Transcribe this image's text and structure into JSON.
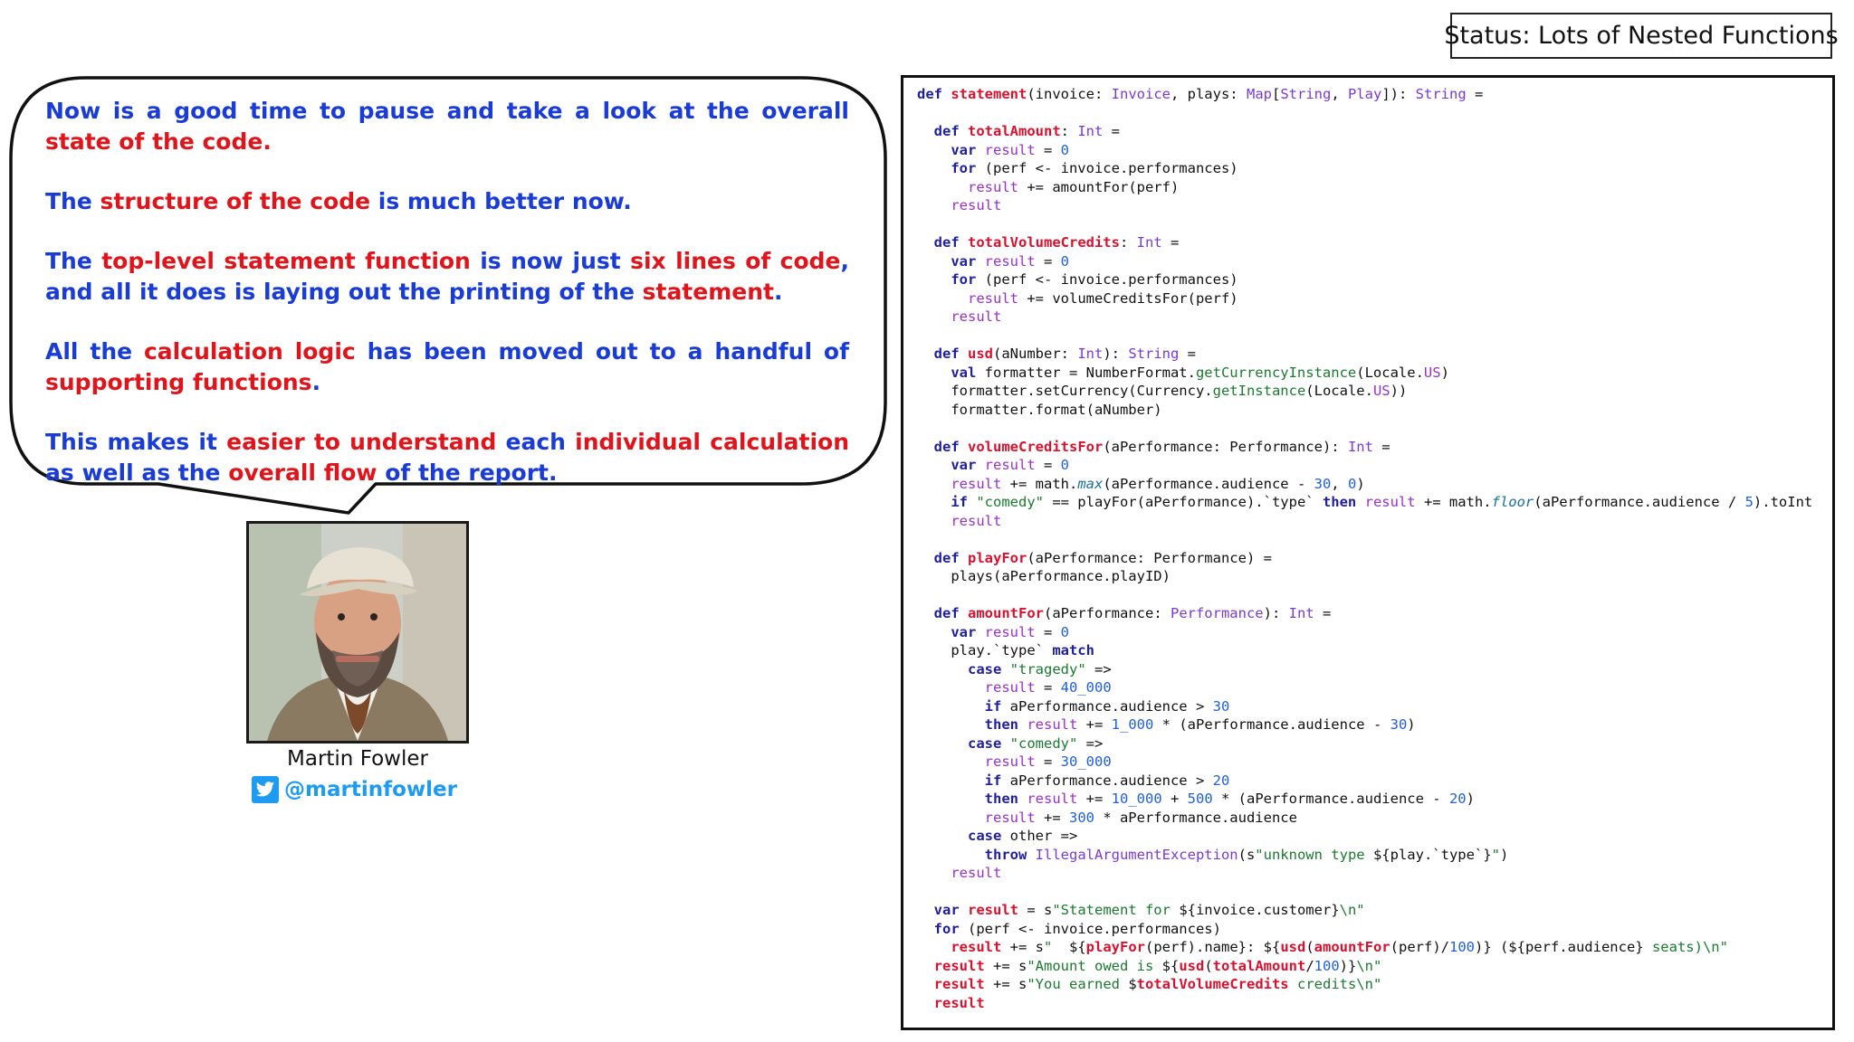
{
  "status": {
    "label": "Status: Lots of Nested Functions"
  },
  "bubble": {
    "paragraphs": [
      [
        {
          "text": "Now is a good time to pause and take a look at the overall ",
          "hl": false
        },
        {
          "text": "state of the code",
          "hl": true
        },
        {
          "text": ".",
          "hl": true
        }
      ],
      [
        {
          "text": "The ",
          "hl": false
        },
        {
          "text": "structure of the code",
          "hl": true
        },
        {
          "text": " is much better now.",
          "hl": false
        }
      ],
      [
        {
          "text": "The ",
          "hl": false
        },
        {
          "text": "top-level statement function",
          "hl": true
        },
        {
          "text": " is now just ",
          "hl": false
        },
        {
          "text": "six lines of code",
          "hl": true
        },
        {
          "text": ", and all it does is laying out the printing of the ",
          "hl": false
        },
        {
          "text": "statement",
          "hl": true
        },
        {
          "text": ".",
          "hl": false
        }
      ],
      [
        {
          "text": "All the ",
          "hl": false
        },
        {
          "text": "calculation logic",
          "hl": true
        },
        {
          "text": " has been moved out to a handful of ",
          "hl": false
        },
        {
          "text": "supporting functions",
          "hl": true
        },
        {
          "text": ".",
          "hl": false
        }
      ],
      [
        {
          "text": "This makes it ",
          "hl": false
        },
        {
          "text": "easier to understand",
          "hl": true
        },
        {
          "text": " each ",
          "hl": false
        },
        {
          "text": "individual calculation",
          "hl": true
        },
        {
          "text": " as well as the ",
          "hl": false
        },
        {
          "text": "overall flow",
          "hl": true
        },
        {
          "text": " of the report.",
          "hl": false
        }
      ]
    ]
  },
  "author": {
    "name": "Martin Fowler",
    "twitter_handle": "@martinfowler",
    "twitter_icon": "twitter-bird-icon",
    "photo_icon": "author-portrait"
  },
  "colors": {
    "highlight": "#e0141b",
    "text": "#1a3cd6",
    "twitter": "#1d9bf0",
    "keyword": "#1f1f9c",
    "function_name": "#d8112e",
    "type": "#7a3ad1",
    "number": "#2060d8"
  },
  "code": {
    "language": "scala",
    "lines": [
      [
        [
          "k",
          "def "
        ],
        [
          "f",
          "statement"
        ],
        [
          "",
          "(invoice: "
        ],
        [
          "t",
          "Invoice"
        ],
        [
          "",
          ", plays: "
        ],
        [
          "t",
          "Map"
        ],
        [
          "",
          "["
        ],
        [
          "t",
          "String"
        ],
        [
          "",
          ", "
        ],
        [
          "t",
          "Play"
        ],
        [
          "",
          "]): "
        ],
        [
          "t",
          "String"
        ],
        [
          "",
          " ="
        ]
      ],
      [],
      [
        [
          "",
          "  "
        ],
        [
          "k",
          "def "
        ],
        [
          "f",
          "totalAmount"
        ],
        [
          "",
          ": "
        ],
        [
          "t",
          "Int"
        ],
        [
          "",
          " ="
        ]
      ],
      [
        [
          "",
          "    "
        ],
        [
          "k",
          "var "
        ],
        [
          "v",
          "result"
        ],
        [
          "",
          " = "
        ],
        [
          "n",
          "0"
        ]
      ],
      [
        [
          "",
          "    "
        ],
        [
          "k",
          "for "
        ],
        [
          "",
          "(perf <- invoice.performances)"
        ]
      ],
      [
        [
          "",
          "      "
        ],
        [
          "v",
          "result"
        ],
        [
          "",
          " += amountFor(perf)"
        ]
      ],
      [
        [
          "",
          "    "
        ],
        [
          "v",
          "result"
        ]
      ],
      [],
      [
        [
          "",
          "  "
        ],
        [
          "k",
          "def "
        ],
        [
          "f",
          "totalVolumeCredits"
        ],
        [
          "",
          ": "
        ],
        [
          "t",
          "Int"
        ],
        [
          "",
          " ="
        ]
      ],
      [
        [
          "",
          "    "
        ],
        [
          "k",
          "var "
        ],
        [
          "v",
          "result"
        ],
        [
          "",
          " = "
        ],
        [
          "n",
          "0"
        ]
      ],
      [
        [
          "",
          "    "
        ],
        [
          "k",
          "for "
        ],
        [
          "",
          "(perf <- invoice.performances)"
        ]
      ],
      [
        [
          "",
          "      "
        ],
        [
          "v",
          "result"
        ],
        [
          "",
          " += volumeCreditsFor(perf)"
        ]
      ],
      [
        [
          "",
          "    "
        ],
        [
          "v",
          "result"
        ]
      ],
      [],
      [
        [
          "",
          "  "
        ],
        [
          "k",
          "def "
        ],
        [
          "f",
          "usd"
        ],
        [
          "",
          "(aNumber: "
        ],
        [
          "t",
          "Int"
        ],
        [
          "",
          "): "
        ],
        [
          "t",
          "String"
        ],
        [
          "",
          " ="
        ]
      ],
      [
        [
          "",
          "    "
        ],
        [
          "k",
          "val "
        ],
        [
          "",
          "formatter = NumberFormat."
        ],
        [
          "s",
          "getCurrencyInstance"
        ],
        [
          "",
          "(Locale."
        ],
        [
          "v",
          "US"
        ],
        [
          "",
          ")"
        ]
      ],
      [
        [
          "",
          "    formatter.setCurrency(Currency."
        ],
        [
          "s",
          "getInstance"
        ],
        [
          "",
          "(Locale."
        ],
        [
          "v",
          "US"
        ],
        [
          "",
          "))"
        ]
      ],
      [
        [
          "",
          "    formatter.format(aNumber)"
        ]
      ],
      [],
      [
        [
          "",
          "  "
        ],
        [
          "k",
          "def "
        ],
        [
          "f",
          "volumeCreditsFor"
        ],
        [
          "",
          "(aPerformance: Performance): "
        ],
        [
          "t",
          "Int"
        ],
        [
          "",
          " ="
        ]
      ],
      [
        [
          "",
          "    "
        ],
        [
          "k",
          "var "
        ],
        [
          "v",
          "result"
        ],
        [
          "",
          " = "
        ],
        [
          "n",
          "0"
        ]
      ],
      [
        [
          "",
          "    "
        ],
        [
          "v",
          "result"
        ],
        [
          "",
          " += math."
        ],
        [
          "i",
          "max"
        ],
        [
          "",
          "(aPerformance.audience - "
        ],
        [
          "n",
          "30"
        ],
        [
          "",
          ", "
        ],
        [
          "n",
          "0"
        ],
        [
          "",
          ")"
        ]
      ],
      [
        [
          "",
          "    "
        ],
        [
          "k",
          "if "
        ],
        [
          "s",
          "\"comedy\""
        ],
        [
          "",
          " == playFor(aPerformance).`type` "
        ],
        [
          "k",
          "then "
        ],
        [
          "v",
          "result"
        ],
        [
          "",
          " += math."
        ],
        [
          "i",
          "floor"
        ],
        [
          "",
          "(aPerformance.audience / "
        ],
        [
          "n",
          "5"
        ],
        [
          "",
          ").toInt"
        ]
      ],
      [
        [
          "",
          "    "
        ],
        [
          "v",
          "result"
        ]
      ],
      [],
      [
        [
          "",
          "  "
        ],
        [
          "k",
          "def "
        ],
        [
          "f",
          "playFor"
        ],
        [
          "",
          "(aPerformance: Performance) ="
        ]
      ],
      [
        [
          "",
          "    plays(aPerformance.playID)"
        ]
      ],
      [],
      [
        [
          "",
          "  "
        ],
        [
          "k",
          "def "
        ],
        [
          "f",
          "amountFor"
        ],
        [
          "",
          "(aPerformance: "
        ],
        [
          "t",
          "Performance"
        ],
        [
          "",
          "): "
        ],
        [
          "t",
          "Int"
        ],
        [
          "",
          " ="
        ]
      ],
      [
        [
          "",
          "    "
        ],
        [
          "k",
          "var "
        ],
        [
          "v",
          "result"
        ],
        [
          "",
          " = "
        ],
        [
          "n",
          "0"
        ]
      ],
      [
        [
          "",
          "    play.`type` "
        ],
        [
          "k",
          "match"
        ]
      ],
      [
        [
          "",
          "      "
        ],
        [
          "k",
          "case "
        ],
        [
          "s",
          "\"tragedy\""
        ],
        [
          "",
          " =>"
        ]
      ],
      [
        [
          "",
          "        "
        ],
        [
          "v",
          "result"
        ],
        [
          "",
          " = "
        ],
        [
          "n",
          "40_000"
        ]
      ],
      [
        [
          "",
          "        "
        ],
        [
          "k",
          "if "
        ],
        [
          "",
          "aPerformance.audience > "
        ],
        [
          "n",
          "30"
        ]
      ],
      [
        [
          "",
          "        "
        ],
        [
          "k",
          "then "
        ],
        [
          "v",
          "result"
        ],
        [
          "",
          " += "
        ],
        [
          "n",
          "1_000"
        ],
        [
          "",
          " * (aPerformance.audience - "
        ],
        [
          "n",
          "30"
        ],
        [
          "",
          ")"
        ]
      ],
      [
        [
          "",
          "      "
        ],
        [
          "k",
          "case "
        ],
        [
          "s",
          "\"comedy\""
        ],
        [
          "",
          " =>"
        ]
      ],
      [
        [
          "",
          "        "
        ],
        [
          "v",
          "result"
        ],
        [
          "",
          " = "
        ],
        [
          "n",
          "30_000"
        ]
      ],
      [
        [
          "",
          "        "
        ],
        [
          "k",
          "if "
        ],
        [
          "",
          "aPerformance.audience > "
        ],
        [
          "n",
          "20"
        ]
      ],
      [
        [
          "",
          "        "
        ],
        [
          "k",
          "then "
        ],
        [
          "v",
          "result"
        ],
        [
          "",
          " += "
        ],
        [
          "n",
          "10_000"
        ],
        [
          "",
          " + "
        ],
        [
          "n",
          "500"
        ],
        [
          "",
          " * (aPerformance.audience - "
        ],
        [
          "n",
          "20"
        ],
        [
          "",
          ")"
        ]
      ],
      [
        [
          "",
          "        "
        ],
        [
          "v",
          "result"
        ],
        [
          "",
          " += "
        ],
        [
          "n",
          "300"
        ],
        [
          "",
          " * aPerformance.audience"
        ]
      ],
      [
        [
          "",
          "      "
        ],
        [
          "k",
          "case "
        ],
        [
          "",
          "other =>"
        ]
      ],
      [
        [
          "",
          "        "
        ],
        [
          "k",
          "throw "
        ],
        [
          "t",
          "IllegalArgumentException"
        ],
        [
          "",
          "(s"
        ],
        [
          "s",
          "\"unknown type "
        ],
        [
          "",
          "${play.`type`}"
        ],
        [
          "s",
          "\""
        ],
        [
          "",
          ")"
        ]
      ],
      [
        [
          "",
          "    "
        ],
        [
          "v",
          "result"
        ]
      ],
      [],
      [
        [
          "",
          "  "
        ],
        [
          "k",
          "var "
        ],
        [
          "f",
          "result"
        ],
        [
          "",
          " = s"
        ],
        [
          "s",
          "\"Statement for "
        ],
        [
          "",
          "${invoice.customer}"
        ],
        [
          "s",
          "\\n\""
        ]
      ],
      [
        [
          "",
          "  "
        ],
        [
          "k",
          "for "
        ],
        [
          "",
          "(perf <- invoice.performances)"
        ]
      ],
      [
        [
          "",
          "    "
        ],
        [
          "f",
          "result"
        ],
        [
          "",
          " += s"
        ],
        [
          "s",
          "\"  "
        ],
        [
          "",
          "${"
        ],
        [
          "f",
          "playFor"
        ],
        [
          "",
          "(perf).name}: ${"
        ],
        [
          "f",
          "usd"
        ],
        [
          "",
          "("
        ],
        [
          "f",
          "amountFor"
        ],
        [
          "",
          "(perf)/"
        ],
        [
          "n",
          "100"
        ],
        [
          "",
          ")} (${perf.audience} "
        ],
        [
          "s",
          "seats)\\n\""
        ]
      ],
      [
        [
          "",
          "  "
        ],
        [
          "f",
          "result"
        ],
        [
          "",
          " += s"
        ],
        [
          "s",
          "\"Amount owed is "
        ],
        [
          "",
          "${"
        ],
        [
          "f",
          "usd"
        ],
        [
          "",
          "("
        ],
        [
          "f",
          "totalAmount"
        ],
        [
          "",
          "/"
        ],
        [
          "n",
          "100"
        ],
        [
          "",
          ")}"
        ],
        [
          "s",
          "\\n\""
        ]
      ],
      [
        [
          "",
          "  "
        ],
        [
          "f",
          "result"
        ],
        [
          "",
          " += s"
        ],
        [
          "s",
          "\"You earned "
        ],
        [
          "",
          "$"
        ],
        [
          "f",
          "totalVolumeCredits"
        ],
        [
          "s",
          " credits\\n\""
        ]
      ],
      [
        [
          "",
          "  "
        ],
        [
          "f",
          "result"
        ]
      ]
    ]
  }
}
